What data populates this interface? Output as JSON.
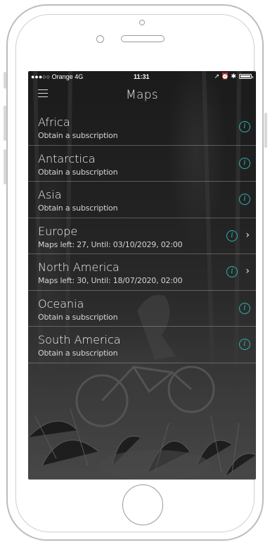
{
  "status_bar": {
    "carrier": "●●●○○ Orange  4G",
    "time": "11:31",
    "indicators": "➚ ⏰ ✱"
  },
  "nav": {
    "title": "Maps",
    "menu_icon": "hamburger-menu-icon"
  },
  "regions": [
    {
      "name": "Africa",
      "subtitle": "Obtain a subscription",
      "has_chevron": false
    },
    {
      "name": "Antarctica",
      "subtitle": "Obtain a subscription",
      "has_chevron": false
    },
    {
      "name": "Asia",
      "subtitle": "Obtain a subscription",
      "has_chevron": false
    },
    {
      "name": "Europe",
      "subtitle": "Maps left: 27, Until: 03/10/2029, 02:00",
      "has_chevron": true
    },
    {
      "name": "North America",
      "subtitle": "Maps left: 30, Until: 18/07/2020, 02:00",
      "has_chevron": true
    },
    {
      "name": "Oceania",
      "subtitle": "Obtain a subscription",
      "has_chevron": false
    },
    {
      "name": "South America",
      "subtitle": "Obtain a subscription",
      "has_chevron": false
    }
  ],
  "icons": {
    "info": "i",
    "chevron": "›"
  },
  "colors": {
    "accent": "#2bb3b1",
    "text": "#f2f2f2",
    "background": "#1e1e1e"
  }
}
